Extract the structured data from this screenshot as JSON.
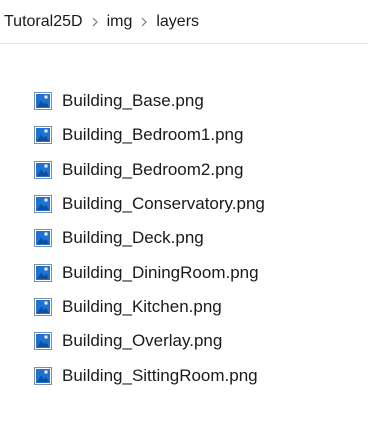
{
  "breadcrumb": {
    "items": [
      "Tutoral25D",
      "img",
      "layers"
    ],
    "separator_icon": "chevron-right-icon"
  },
  "files": {
    "icon": "png-image-file-icon",
    "items": [
      "Building_Base.png",
      "Building_Bedroom1.png",
      "Building_Bedroom2.png",
      "Building_Conservatory.png",
      "Building_Deck.png",
      "Building_DiningRoom.png",
      "Building_Kitchen.png",
      "Building_Overlay.png",
      "Building_SittingRoom.png"
    ]
  },
  "colors": {
    "icon_blue": "#1e73d2",
    "icon_dark_blue": "#0f4f9e",
    "icon_border": "#7f8ea3",
    "separator": "#7a7a7a"
  }
}
